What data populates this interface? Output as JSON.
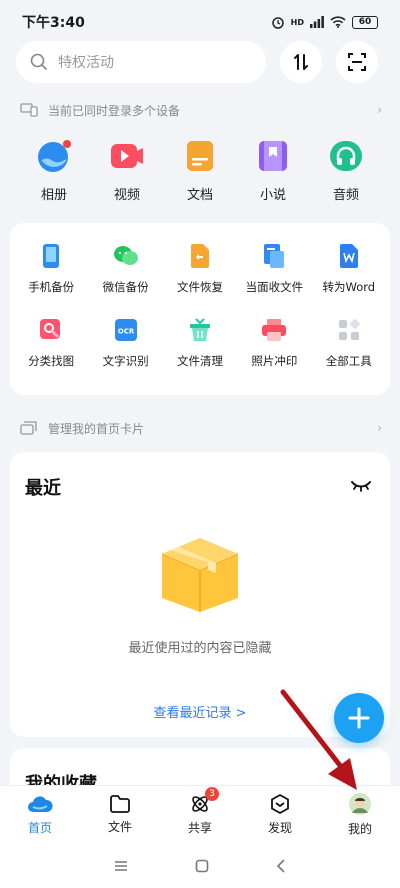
{
  "status": {
    "time": "下午3:40",
    "signal_label": "HD",
    "battery": "60"
  },
  "search": {
    "placeholder": "特权活动"
  },
  "devices_banner": {
    "text": "当前已同时登录多个设备"
  },
  "top_icons": [
    {
      "label": "相册",
      "icon": "album-icon"
    },
    {
      "label": "视频",
      "icon": "video-icon"
    },
    {
      "label": "文档",
      "icon": "document-icon"
    },
    {
      "label": "小说",
      "icon": "novel-icon"
    },
    {
      "label": "音频",
      "icon": "audio-icon"
    }
  ],
  "tools": [
    {
      "label": "手机备份",
      "icon": "phone-backup-icon",
      "color": "#2d8cf0"
    },
    {
      "label": "微信备份",
      "icon": "wechat-backup-icon",
      "color": "#20c65a"
    },
    {
      "label": "文件恢复",
      "icon": "file-restore-icon",
      "color": "#f7a531"
    },
    {
      "label": "当面收文件",
      "icon": "receive-file-icon",
      "color": "#2d8cf0"
    },
    {
      "label": "转为Word",
      "icon": "word-icon",
      "color": "#2d7ff0"
    },
    {
      "label": "分类找图",
      "icon": "find-image-icon",
      "color": "#ff5470"
    },
    {
      "label": "文字识别",
      "icon": "ocr-icon",
      "color": "#2d8cf0"
    },
    {
      "label": "文件清理",
      "icon": "clean-icon",
      "color": "#22c7a0"
    },
    {
      "label": "照片冲印",
      "icon": "photo-print-icon",
      "color": "#ff4d5f"
    },
    {
      "label": "全部工具",
      "icon": "all-tools-icon",
      "color": "#c8cdd3"
    }
  ],
  "manage_banner": {
    "text": "管理我的首页卡片"
  },
  "recent": {
    "title": "最近",
    "hidden_text": "最近使用过的内容已隐藏",
    "view_link": "查看最近记录 >"
  },
  "favorites": {
    "title": "我的收藏"
  },
  "bottom_nav": [
    {
      "label": "首页",
      "icon": "home-cloud-icon",
      "active": true
    },
    {
      "label": "文件",
      "icon": "folder-icon",
      "active": false
    },
    {
      "label": "共享",
      "icon": "share-atom-icon",
      "active": false,
      "badge": "3"
    },
    {
      "label": "发现",
      "icon": "discover-icon",
      "active": false
    },
    {
      "label": "我的",
      "icon": "avatar-icon",
      "active": false
    }
  ],
  "colors": {
    "accent": "#1e88e5",
    "fab": "#1da1f2",
    "annotation_arrow": "#b3141a"
  }
}
